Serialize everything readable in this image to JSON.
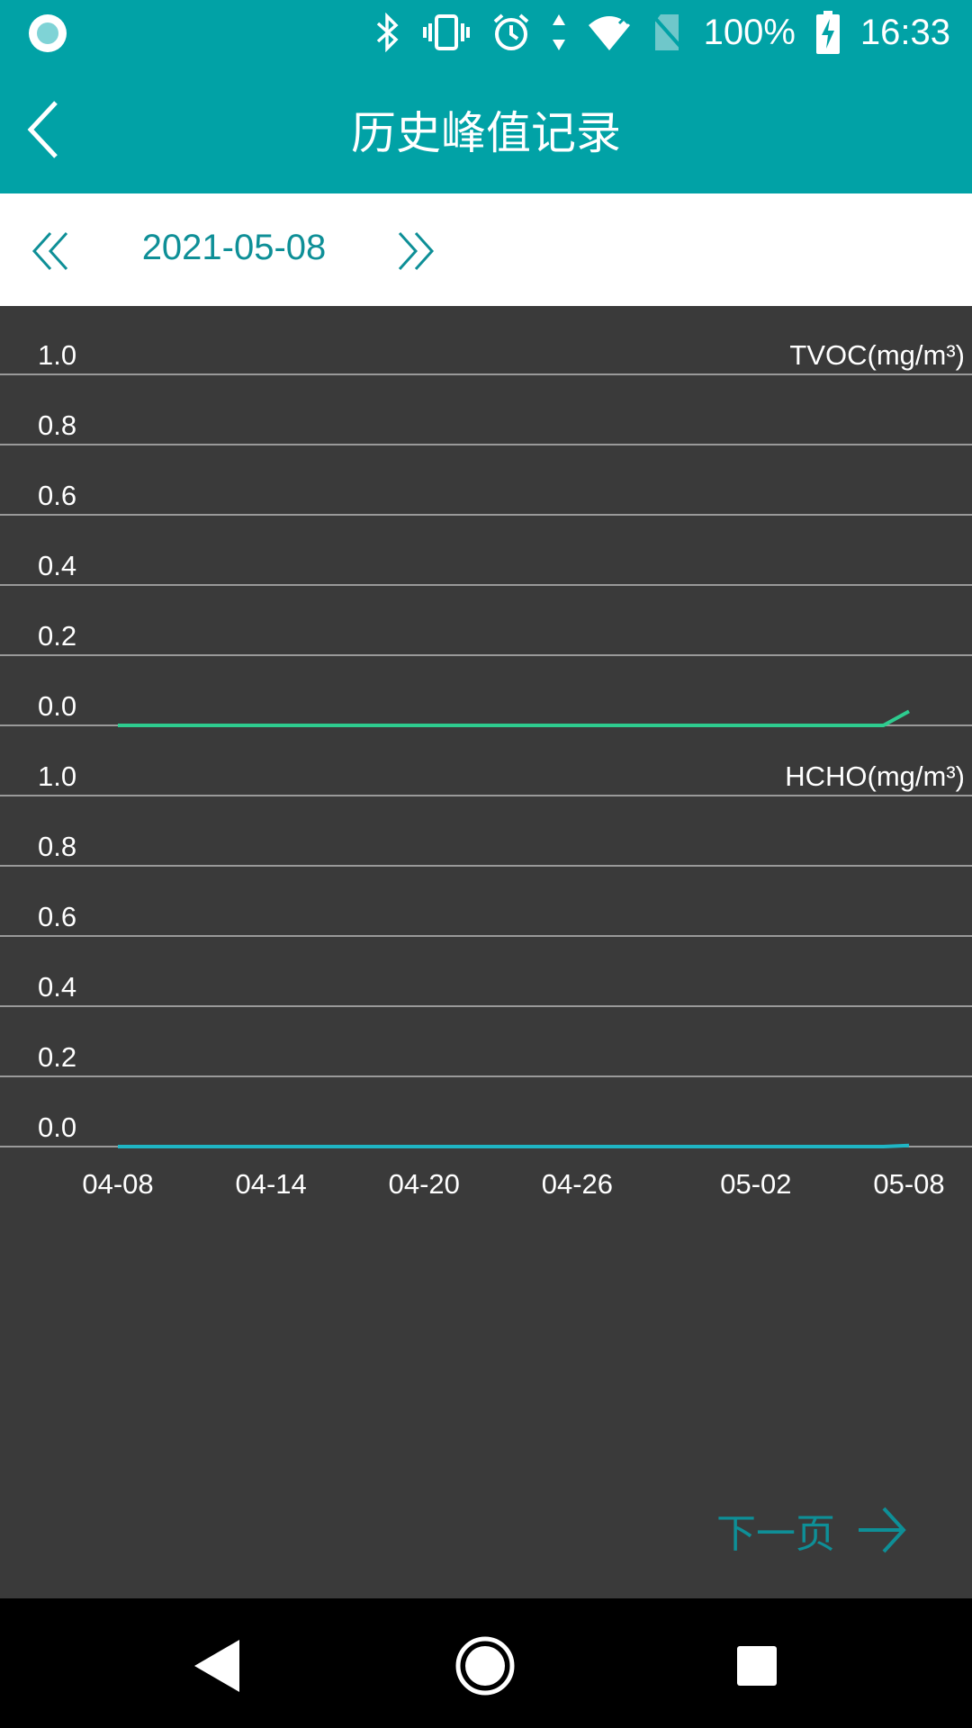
{
  "status_bar": {
    "battery": "100%",
    "time": "16:33",
    "icons": [
      "app-notification-icon",
      "bluetooth-icon",
      "vibrate-icon",
      "alarm-icon",
      "data-arrows-icon",
      "wifi-icon",
      "no-sim-icon",
      "battery-charging-icon"
    ]
  },
  "app_bar": {
    "title": "历史峰值记录",
    "back_icon": "chevron-left-icon"
  },
  "date_bar": {
    "date": "2021-05-08",
    "prev_icon": "double-chevron-left-icon",
    "next_icon": "double-chevron-right-icon"
  },
  "footer": {
    "next_page_label": "下一页",
    "next_page_icon": "arrow-right-icon"
  },
  "nav_bar": {
    "icons": [
      "nav-back-icon",
      "nav-home-icon",
      "nav-recents-icon"
    ]
  },
  "colors": {
    "primary": "#01a2a6",
    "accent_text": "#0e8f97",
    "tvoc_line": "#2ecc8f",
    "hcho_line": "#1fb5c4",
    "chart_bg": "#3a3a3a",
    "grid": "#9a9a9a"
  },
  "chart_data": [
    {
      "type": "line",
      "unit_label": "TVOC(mg/m³)",
      "ylim": [
        0,
        1.0
      ],
      "y_ticks": [
        "1.0",
        "0.8",
        "0.6",
        "0.4",
        "0.2",
        "0.0"
      ],
      "x_ticks": [
        "04-08",
        "04-14",
        "04-20",
        "04-26",
        "05-02",
        "05-08"
      ],
      "xlim": [
        "04-08",
        "05-08"
      ],
      "grid": true,
      "series": [
        {
          "color": "#2ecc8f",
          "points": [
            [
              "04-08",
              0.0
            ],
            [
              "05-01",
              0.0
            ],
            [
              "05-07",
              0.0
            ],
            [
              "05-08",
              0.04
            ]
          ]
        }
      ]
    },
    {
      "type": "line",
      "unit_label": "HCHO(mg/m³)",
      "ylim": [
        0,
        1.0
      ],
      "y_ticks": [
        "1.0",
        "0.8",
        "0.6",
        "0.4",
        "0.2",
        "0.0"
      ],
      "x_ticks": [
        "04-08",
        "04-14",
        "04-20",
        "04-26",
        "05-02",
        "05-08"
      ],
      "xlim": [
        "04-08",
        "05-08"
      ],
      "grid": true,
      "series": [
        {
          "color": "#1fb5c4",
          "points": [
            [
              "04-08",
              0.0
            ],
            [
              "05-07",
              0.0
            ],
            [
              "05-08",
              0.003
            ]
          ]
        }
      ]
    }
  ]
}
